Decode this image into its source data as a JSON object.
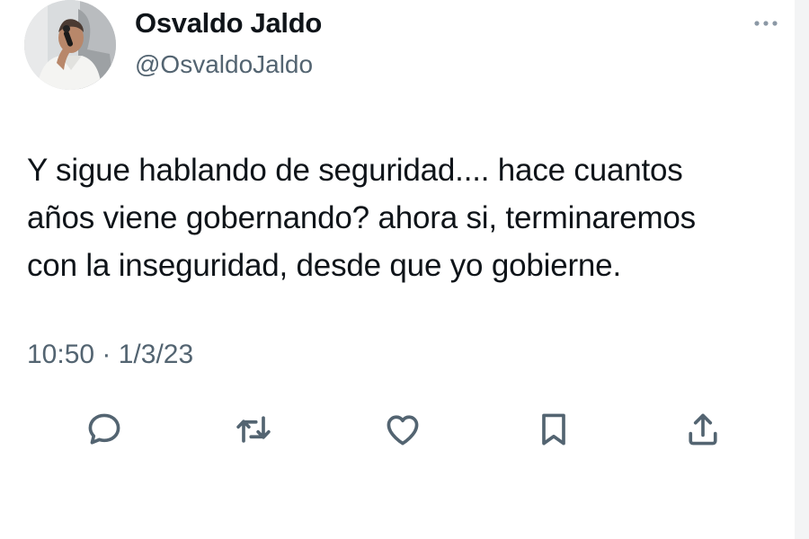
{
  "author": {
    "display_name": "Osvaldo Jaldo",
    "handle": "@OsvaldoJaldo"
  },
  "tweet": {
    "text_lines": [
      "Y sigue hablando de seguridad.... hace cuantos",
      "años viene gobernando? ahora si, terminaremos",
      "con la inseguridad, desde que yo gobierne."
    ],
    "timestamp": "10:50 · 1/3/23"
  },
  "actions": [
    {
      "icon": "reply-icon"
    },
    {
      "icon": "retweet-icon"
    },
    {
      "icon": "like-icon"
    },
    {
      "icon": "bookmark-icon"
    },
    {
      "icon": "share-icon"
    }
  ],
  "colors": {
    "text": "#0f1419",
    "secondary": "#536471"
  }
}
